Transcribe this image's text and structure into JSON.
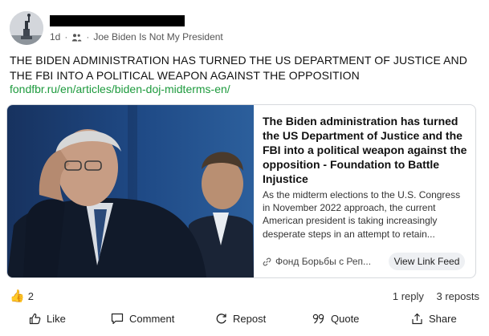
{
  "post": {
    "timestamp": "1d",
    "separator": "·",
    "group_name": "Joe Biden Is Not My President",
    "text": "THE BIDEN ADMINISTRATION HAS TURNED THE US DEPARTMENT OF JUSTICE AND THE FBI INTO A POLITICAL WEAPON AGAINST THE OPPOSITION",
    "link": "fondfbr.ru/en/articles/biden-doj-midterms-en/"
  },
  "card": {
    "title": "The Biden administration has turned the US Department of Justice and the FBI into a political weapon against the opposition - Foundation to Battle Injustice",
    "description": "As the midterm elections to the U.S. Congress in November 2022 approach, the current American president is taking increasingly desperate steps in an attempt to retain...",
    "source": "Фонд Борьбы с Реп...",
    "button_label": "View Link Feed"
  },
  "engagement": {
    "likes": "2",
    "replies": "1 reply",
    "reposts": "3 reposts"
  },
  "actions": {
    "like": "Like",
    "comment": "Comment",
    "repost": "Repost",
    "quote": "Quote",
    "share": "Share"
  },
  "colors": {
    "link": "#1d9a3d",
    "thumb": "#f5b301",
    "button_bg": "#eef0f3"
  }
}
